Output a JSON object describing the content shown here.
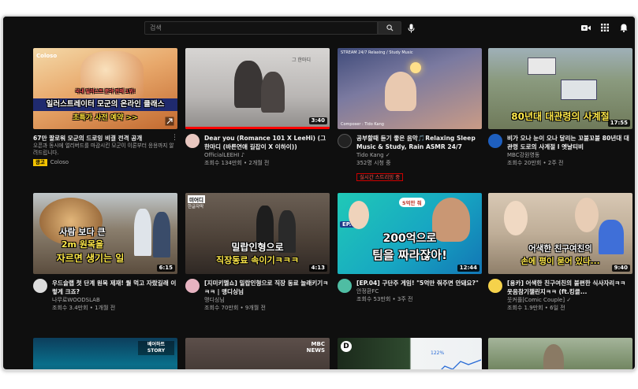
{
  "search": {
    "placeholder": "검색"
  },
  "icons": {
    "search": "search-icon",
    "mic": "mic-icon",
    "create": "video-camera-icon",
    "apps": "apps-grid-icon",
    "notifications": "bell-icon"
  },
  "videos": [
    {
      "thumb_text_top": "국내 일러스트 분야 판매 1위!",
      "thumb_text_main": "일러스트레이터 모군의 온라인 클래스",
      "thumb_text_cta": "초특가 사전 예약 >>",
      "brand": "Coloso",
      "title": "67만 팔로워 모군의 드로잉 비결 전격 공개",
      "description": "오픈과 동시에 얼리버드를 마감시킨 모군이 이론부터 응용까지 알려드립니다.",
      "ad_badge": "광고",
      "channel": "Coloso"
    },
    {
      "thumb_text": "그 한마디",
      "duration": "3:40",
      "progress": 1.0,
      "title": "Dear you (Romance 101 X LeeHi) (그 한마디 (바른연애 길잡이 X 이하이))",
      "channel": "OfficialLEEHI ♪",
      "stats": "조회수 134만회 • 2개월 전"
    },
    {
      "thumb_text": "STREAM 24/7 Relaxing / Study Music",
      "thumb_caption": "Composer : Tido Kang",
      "title": "공부할때 듣기 좋은 음악🎵Relaxing Sleep Music & Study, Rain ASMR 24/7",
      "channel": "Tido Kang ✓",
      "stats": "352명 시청 중",
      "live_badge": "실시간 스트리밍 중"
    },
    {
      "thumb_text": "80년대 대관령의 사계절",
      "duration": "17:55",
      "title": "비가 오나 눈이 오나 달리는 꼬불꼬불 80년대 대관령 도로의 사계절 l 옛날티비",
      "channel": "MBC강원영동",
      "stats": "조회수 20만회 • 2주 전"
    },
    {
      "thumb_text_line1": "사람 보다 큰",
      "thumb_text_line2": "2m 원목을",
      "thumb_text_line3": "자르면 생기는 일",
      "duration": "6:15",
      "title": "우드슬랩 첫 단계 원목 제재! 월 먹고 자랐길래 이렇게 크죠?",
      "channel": "나무로WOODSLAB",
      "stats": "조회수 3.4만회 • 1개월 전"
    },
    {
      "thumb_badge": "미어디",
      "thumb_badge_sub": "한글자막",
      "thumb_text_line1": "밀랍인형으로",
      "thumb_text_line2": "직장동료 속이기ㅋㅋㅋ",
      "duration": "4:13",
      "title": "[지미키멜쇼] 밀랍인형으로 직장 동료 놀래키기ㅋㅋㅋ | 맹디싱님",
      "channel": "맹디싱님",
      "stats": "조회수 70만회 • 9개월 전"
    },
    {
      "thumb_tag": "EP.04",
      "thumb_bubble": "5억만 줘 ",
      "thumb_text_line1": "200억으로",
      "thumb_text_line2": "팀을 짜라잖아!",
      "duration": "12:44",
      "title": "[EP.04] 구단주 게임! \"5억만 줘주면 안돼요?\"",
      "channel": "안정환FC",
      "stats": "조회수 53만회 • 3주 전"
    },
    {
      "thumb_text_line1": "어색한 친구여친의",
      "thumb_text_line2": "손에 평이 묻어 있다...",
      "duration": "9:40",
      "title": "[용카] 어색한 친구여친의 불편한 식사자리ㅋㅋ 웃음참기챌린지ㅋㅋ (ft.킹클...",
      "channel": "웃커플[Comic Couple] ✓",
      "stats": "조회수 1.9만회 • 6일 전"
    },
    {
      "thumb_text": "베어하트 STORY"
    },
    {
      "thumb_text": "MBC NEWS"
    },
    {
      "thumb_text": "D"
    },
    {
      "thumb_text": "122%"
    }
  ],
  "colors": {
    "bg": "#0f0f0f",
    "live_red": "#ff4e45",
    "progress_red": "#ff0000",
    "ad_yellow": "#f2c200"
  }
}
